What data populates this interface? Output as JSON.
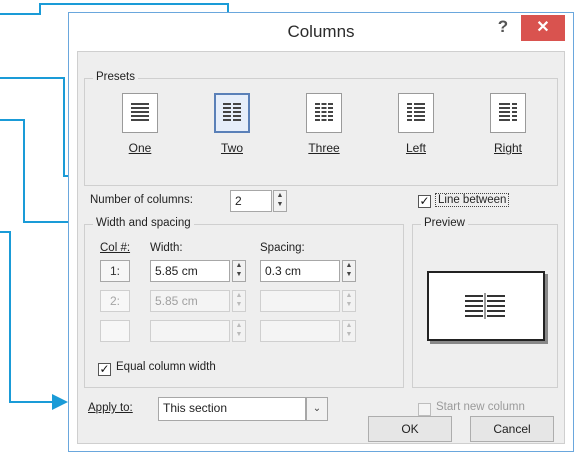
{
  "dialog": {
    "title": "Columns",
    "help_label": "?",
    "close_label": "✕"
  },
  "presets": {
    "legend": "Presets",
    "items": [
      {
        "label": "One"
      },
      {
        "label": "Two"
      },
      {
        "label": "Three"
      },
      {
        "label": "Left"
      },
      {
        "label": "Right"
      }
    ],
    "selected": "Two"
  },
  "number_of_columns": {
    "label": "Number of columns:",
    "value": "2"
  },
  "line_between": {
    "label": "Line between",
    "checked": true
  },
  "width_spacing": {
    "legend": "Width and spacing",
    "col_header": "Col #:",
    "width_header": "Width:",
    "spacing_header": "Spacing:",
    "rows": [
      {
        "col": "1:",
        "width": "5.85 cm",
        "spacing": "0.3 cm"
      },
      {
        "col": "2:",
        "width": "5.85 cm",
        "spacing": ""
      },
      {
        "col": "",
        "width": "",
        "spacing": ""
      }
    ]
  },
  "equal_column_width": {
    "label": "Equal column width",
    "checked": true
  },
  "preview": {
    "legend": "Preview"
  },
  "apply_to": {
    "label": "Apply to:",
    "value": "This section"
  },
  "start_new_column": {
    "label": "Start new column",
    "checked": false
  },
  "buttons": {
    "ok": "OK",
    "cancel": "Cancel"
  },
  "colors": {
    "annotation_arrow": "#1a9bd7",
    "close_button": "#d9534f",
    "dialog_border": "#6aa7dd"
  }
}
